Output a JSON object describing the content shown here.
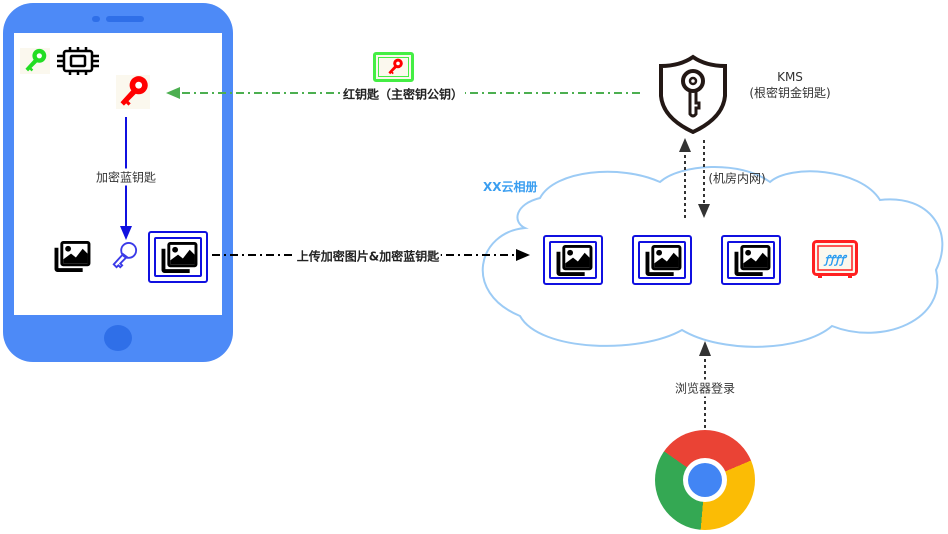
{
  "phone": {
    "encrypt_label": "加密蓝钥匙"
  },
  "arrows": {
    "red_key_label": "红钥匙（主密钥公钥）",
    "upload_label": "上传加密图片&加密蓝钥匙",
    "intranet_label": "(机房内网)",
    "browser_label": "浏览器登录"
  },
  "kms": {
    "title": "KMS",
    "subtitle": "(根密钥金钥匙)"
  },
  "cloud": {
    "title": "XX云相册"
  },
  "colors": {
    "phone": "#4d8af7",
    "blue_key": "#1010e0",
    "green_line": "#4caf50",
    "red_key": "#ff0000",
    "cloud_stroke": "#9ccbf5",
    "cloud_title": "#3a9ef0"
  },
  "icons": [
    "green-key-icon",
    "chip-icon",
    "red-key-icon",
    "gallery-icon",
    "blue-key-icon",
    "shield-key-icon",
    "safe-icon",
    "chrome-icon"
  ]
}
